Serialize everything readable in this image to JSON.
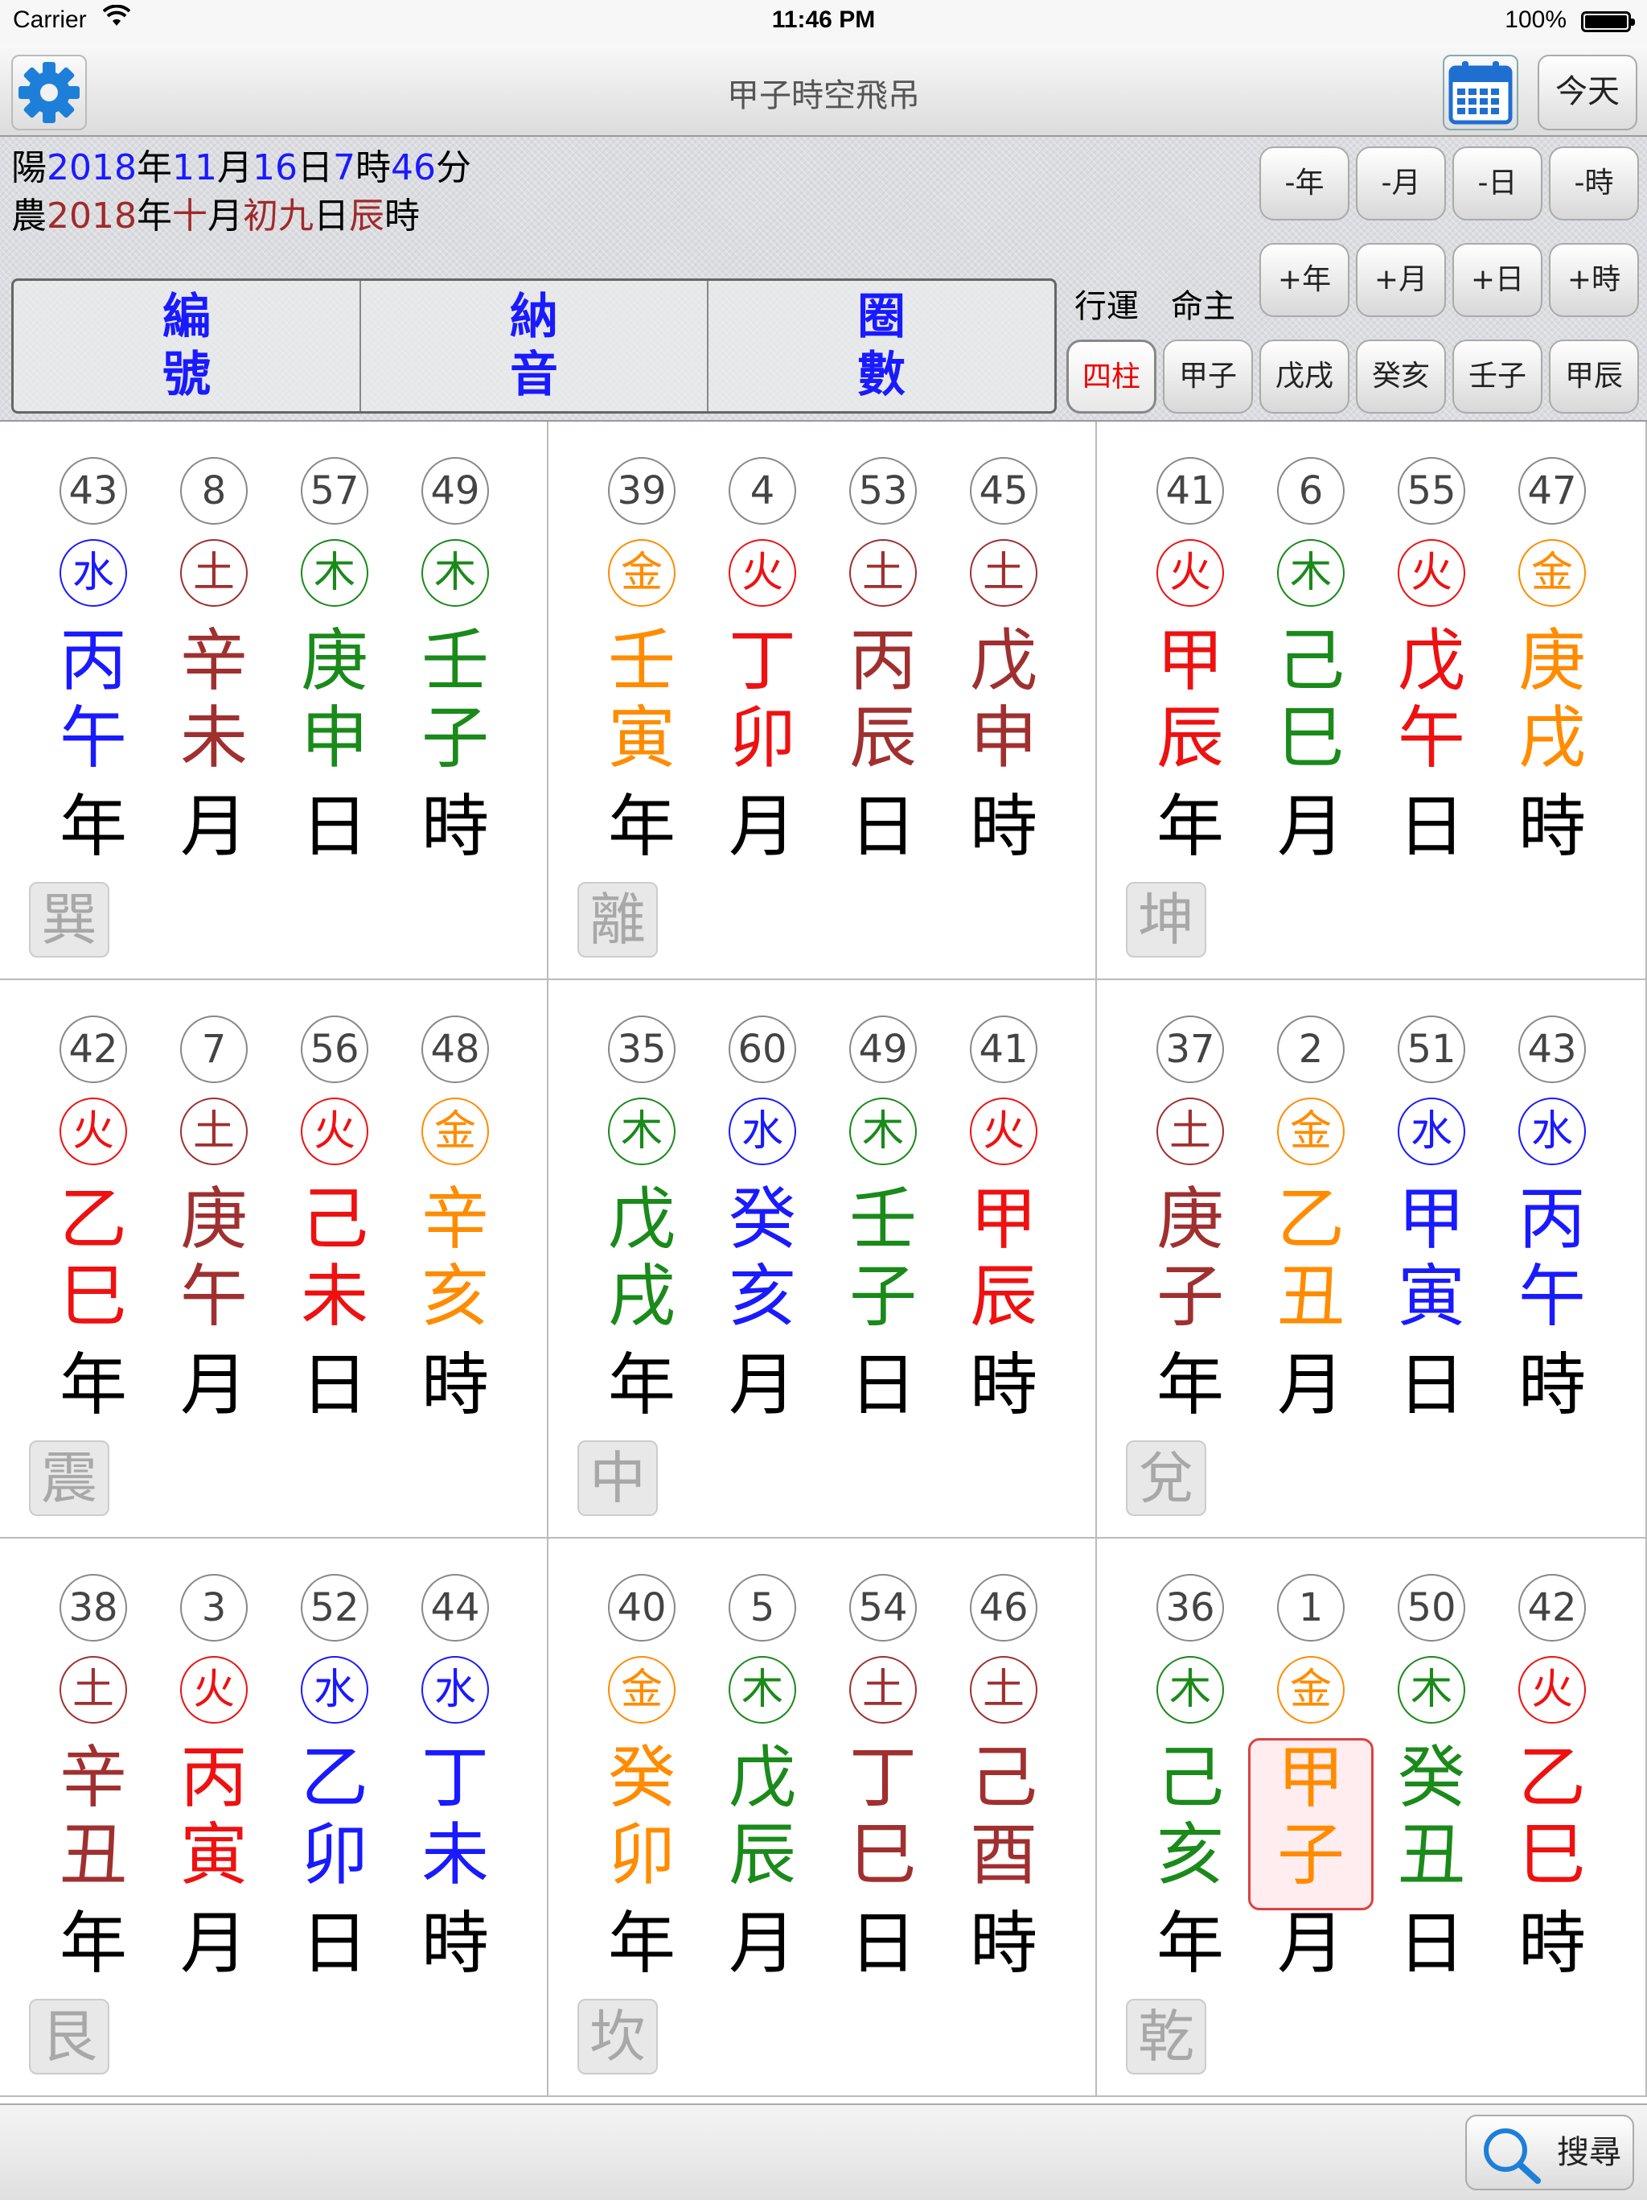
{
  "status_bar": {
    "carrier": "Carrier",
    "time": "11:46 PM",
    "battery": "100%"
  },
  "nav": {
    "title": "甲子時空飛吊",
    "today_label": "今天"
  },
  "solar_date": {
    "prefix": "陽",
    "year": "2018",
    "year_unit": "年",
    "month": "11",
    "month_unit": "月",
    "day": "16",
    "day_unit": "日",
    "hour": "7",
    "hour_unit": "時",
    "minute": "46",
    "minute_unit": "分"
  },
  "lunar_date": {
    "prefix": "農",
    "year": "2018",
    "year_unit": "年",
    "month": "十",
    "month_unit": "月",
    "day": "初九",
    "day_unit": "日",
    "hour": "辰",
    "hour_unit": "時"
  },
  "modes": [
    {
      "line1": "編",
      "line2": "號"
    },
    {
      "line1": "納",
      "line2": "音"
    },
    {
      "line1": "圈",
      "line2": "數"
    }
  ],
  "adjust_buttons": {
    "minus_year": "-年",
    "minus_month": "-月",
    "minus_day": "-日",
    "minus_hour": "-時",
    "plus_year": "+年",
    "plus_month": "+月",
    "plus_day": "+日",
    "plus_hour": "+時"
  },
  "labels": {
    "luck": "行運",
    "master": "命主"
  },
  "pillar_buttons": [
    "四柱",
    "甲子",
    "戊戌",
    "癸亥",
    "壬子",
    "甲辰"
  ],
  "colors": {
    "water": "#1a1aff",
    "earth": "#a03030",
    "wood": "#1a8a1a",
    "fire": "#ee1111",
    "metal": "#ff8c00"
  },
  "periods": [
    "年",
    "月",
    "日",
    "時"
  ],
  "cells": [
    {
      "trigram": "巽",
      "pillars": [
        {
          "num": "43",
          "element": "水",
          "stem": "丙",
          "branch": "午",
          "color": "water"
        },
        {
          "num": "8",
          "element": "土",
          "stem": "辛",
          "branch": "未",
          "color": "earth"
        },
        {
          "num": "57",
          "element": "木",
          "stem": "庚",
          "branch": "申",
          "color": "wood"
        },
        {
          "num": "49",
          "element": "木",
          "stem": "壬",
          "branch": "子",
          "color": "wood"
        }
      ]
    },
    {
      "trigram": "離",
      "pillars": [
        {
          "num": "39",
          "element": "金",
          "stem": "壬",
          "branch": "寅",
          "color": "metal"
        },
        {
          "num": "4",
          "element": "火",
          "stem": "丁",
          "branch": "卯",
          "color": "fire"
        },
        {
          "num": "53",
          "element": "土",
          "stem": "丙",
          "branch": "辰",
          "color": "earth"
        },
        {
          "num": "45",
          "element": "土",
          "stem": "戊",
          "branch": "申",
          "color": "earth"
        }
      ]
    },
    {
      "trigram": "坤",
      "pillars": [
        {
          "num": "41",
          "element": "火",
          "stem": "甲",
          "branch": "辰",
          "color": "fire"
        },
        {
          "num": "6",
          "element": "木",
          "stem": "己",
          "branch": "巳",
          "color": "wood"
        },
        {
          "num": "55",
          "element": "火",
          "stem": "戊",
          "branch": "午",
          "color": "fire"
        },
        {
          "num": "47",
          "element": "金",
          "stem": "庚",
          "branch": "戌",
          "color": "metal"
        }
      ]
    },
    {
      "trigram": "震",
      "pillars": [
        {
          "num": "42",
          "element": "火",
          "stem": "乙",
          "branch": "巳",
          "color": "fire"
        },
        {
          "num": "7",
          "element": "土",
          "stem": "庚",
          "branch": "午",
          "color": "earth"
        },
        {
          "num": "56",
          "element": "火",
          "stem": "己",
          "branch": "未",
          "color": "fire"
        },
        {
          "num": "48",
          "element": "金",
          "stem": "辛",
          "branch": "亥",
          "color": "metal"
        }
      ]
    },
    {
      "trigram": "中",
      "pillars": [
        {
          "num": "35",
          "element": "木",
          "stem": "戊",
          "branch": "戌",
          "color": "wood"
        },
        {
          "num": "60",
          "element": "水",
          "stem": "癸",
          "branch": "亥",
          "color": "water"
        },
        {
          "num": "49",
          "element": "木",
          "stem": "壬",
          "branch": "子",
          "color": "wood"
        },
        {
          "num": "41",
          "element": "火",
          "stem": "甲",
          "branch": "辰",
          "color": "fire"
        }
      ]
    },
    {
      "trigram": "兌",
      "pillars": [
        {
          "num": "37",
          "element": "土",
          "stem": "庚",
          "branch": "子",
          "color": "earth"
        },
        {
          "num": "2",
          "element": "金",
          "stem": "乙",
          "branch": "丑",
          "color": "metal"
        },
        {
          "num": "51",
          "element": "水",
          "stem": "甲",
          "branch": "寅",
          "color": "water"
        },
        {
          "num": "43",
          "element": "水",
          "stem": "丙",
          "branch": "午",
          "color": "water"
        }
      ]
    },
    {
      "trigram": "艮",
      "pillars": [
        {
          "num": "38",
          "element": "土",
          "stem": "辛",
          "branch": "丑",
          "color": "earth"
        },
        {
          "num": "3",
          "element": "火",
          "stem": "丙",
          "branch": "寅",
          "color": "fire"
        },
        {
          "num": "52",
          "element": "水",
          "stem": "乙",
          "branch": "卯",
          "color": "water"
        },
        {
          "num": "44",
          "element": "水",
          "stem": "丁",
          "branch": "未",
          "color": "water"
        }
      ]
    },
    {
      "trigram": "坎",
      "pillars": [
        {
          "num": "40",
          "element": "金",
          "stem": "癸",
          "branch": "卯",
          "color": "metal"
        },
        {
          "num": "5",
          "element": "木",
          "stem": "戊",
          "branch": "辰",
          "color": "wood"
        },
        {
          "num": "54",
          "element": "土",
          "stem": "丁",
          "branch": "巳",
          "color": "earth"
        },
        {
          "num": "46",
          "element": "土",
          "stem": "己",
          "branch": "酉",
          "color": "earth"
        }
      ]
    },
    {
      "trigram": "乾",
      "pillars": [
        {
          "num": "36",
          "element": "木",
          "stem": "己",
          "branch": "亥",
          "color": "wood"
        },
        {
          "num": "1",
          "element": "金",
          "stem": "甲",
          "branch": "子",
          "color": "metal",
          "highlight": true
        },
        {
          "num": "50",
          "element": "木",
          "stem": "癸",
          "branch": "丑",
          "color": "wood"
        },
        {
          "num": "42",
          "element": "火",
          "stem": "乙",
          "branch": "巳",
          "color": "fire"
        }
      ]
    }
  ],
  "toolbar": {
    "search_label": "搜尋"
  }
}
